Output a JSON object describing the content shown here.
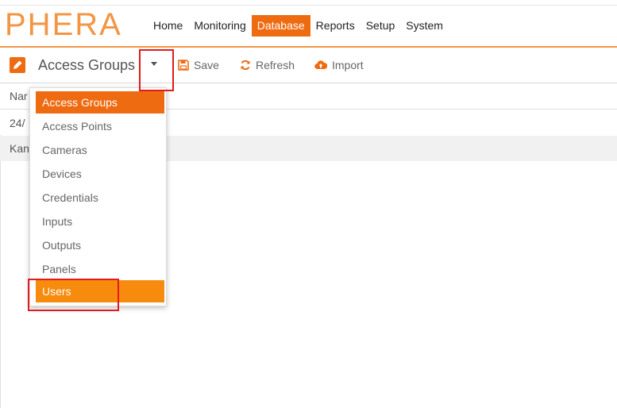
{
  "brand": {
    "logo_text": "PHERA",
    "accent": "#ee6b12"
  },
  "nav": {
    "items": [
      {
        "label": "Home"
      },
      {
        "label": "Monitoring"
      },
      {
        "label": "Database",
        "active": true
      },
      {
        "label": "Reports"
      },
      {
        "label": "Setup"
      },
      {
        "label": "System"
      }
    ]
  },
  "toolbar": {
    "title": "Access Groups",
    "save_label": "Save",
    "refresh_label": "Refresh",
    "import_label": "Import"
  },
  "table": {
    "header_name": "Nar",
    "rows": [
      {
        "name": "24/"
      },
      {
        "name": "Kan"
      }
    ]
  },
  "dropdown": {
    "items": [
      {
        "label": "Access Groups",
        "state": "selected"
      },
      {
        "label": "Access Points"
      },
      {
        "label": "Cameras"
      },
      {
        "label": "Devices"
      },
      {
        "label": "Credentials"
      },
      {
        "label": "Inputs"
      },
      {
        "label": "Outputs"
      },
      {
        "label": "Panels"
      },
      {
        "label": "Users",
        "state": "hover"
      }
    ]
  },
  "annotation_color": "#e21b1b"
}
